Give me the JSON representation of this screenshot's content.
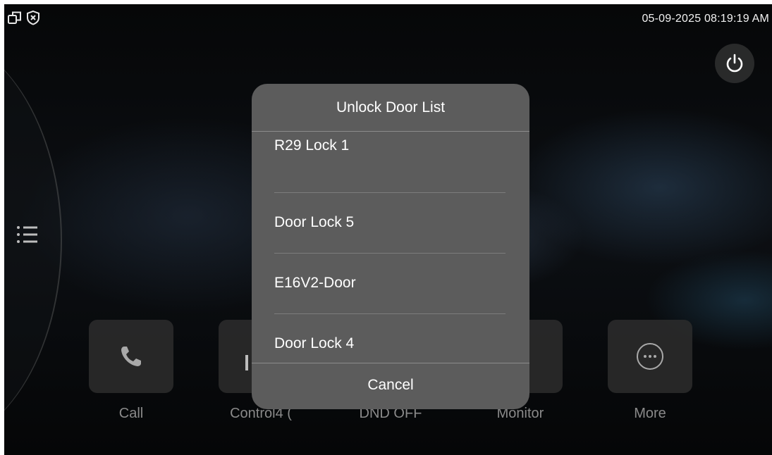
{
  "status_bar": {
    "datetime": "05-09-2025 08:19:19 AM",
    "left_icons": [
      "window-restore-icon",
      "shield-x-icon"
    ]
  },
  "power_button": {
    "icon": "power-icon"
  },
  "side_menu": {
    "icon": "list-menu-icon"
  },
  "home_tiles": [
    {
      "label": "Call",
      "icon": "phone-icon"
    },
    {
      "label": "Control4 (",
      "icon": ""
    },
    {
      "label": "DND OFF",
      "icon": ""
    },
    {
      "label": "Monitor",
      "icon": ""
    },
    {
      "label": "More",
      "icon": "more-dots-icon"
    }
  ],
  "dialog": {
    "title": "Unlock Door List",
    "items": [
      "R29 Lock 1",
      "Door Lock 5",
      "E16V2-Door",
      "Door Lock 4"
    ],
    "cancel_label": "Cancel"
  },
  "colors": {
    "dialog_bg": "#5c5c5c",
    "tile_bg": "#2d2d2d",
    "text": "#ffffff",
    "muted_text": "#8a8a8a"
  }
}
